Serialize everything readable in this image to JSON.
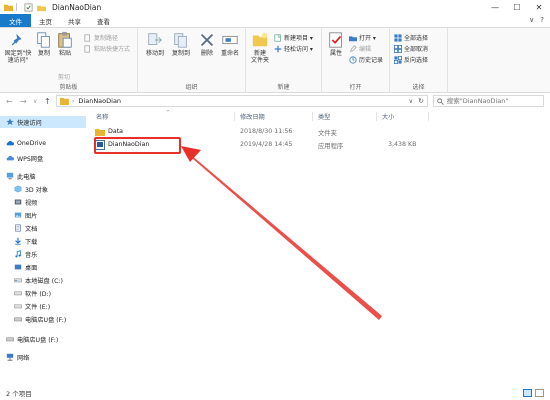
{
  "window": {
    "title": "DianNaoDian",
    "minimize": "—",
    "maximize": "☐",
    "close": "✕"
  },
  "tabs": [
    {
      "label": "文件"
    },
    {
      "label": "主页"
    },
    {
      "label": "共享"
    },
    {
      "label": "查看"
    }
  ],
  "tabs_right": {
    "collapse": "∨",
    "help": "?"
  },
  "ribbon": {
    "clipboard": {
      "label": "剪贴板",
      "pin": "固定到\"快\n速访问\"",
      "copy": "复制",
      "paste": "粘贴",
      "copy_path": "复制路径",
      "paste_shortcut": "粘贴快捷方式",
      "cut": "剪切"
    },
    "organize": {
      "label": "组织",
      "move_to": "移动到",
      "copy_to": "复制到",
      "delete": "删除",
      "rename": "重命名"
    },
    "new": {
      "label": "新建",
      "new_folder": "新建\n文件夹",
      "new_item": "新建项目 ▾",
      "easy_access": "轻松访问 ▾"
    },
    "open": {
      "label": "打开",
      "properties": "属性",
      "open": "打开 ▾",
      "edit": "编辑",
      "history": "历史记录"
    },
    "select": {
      "label": "选择",
      "select_all": "全部选择",
      "select_none": "全部取消",
      "invert": "反向选择"
    }
  },
  "address": {
    "back": "←",
    "forward": "→",
    "recent": "∨",
    "up": "↑",
    "path": "DianNaoDian",
    "dropdown": "∨",
    "refresh": "↻",
    "search_placeholder": "搜索\"DianNaoDian\""
  },
  "nav": [
    {
      "label": "快速访问",
      "icon": "star-icon"
    },
    {
      "label": "OneDrive",
      "icon": "cloud-icon"
    },
    {
      "label": "WPS网盘",
      "icon": "cloud-icon"
    },
    {
      "label": "此电脑",
      "icon": "computer-icon"
    },
    {
      "label": "3D 对象",
      "icon": "cube-icon"
    },
    {
      "label": "视频",
      "icon": "video-icon"
    },
    {
      "label": "图片",
      "icon": "picture-icon"
    },
    {
      "label": "文档",
      "icon": "document-icon"
    },
    {
      "label": "下载",
      "icon": "download-icon"
    },
    {
      "label": "音乐",
      "icon": "music-icon"
    },
    {
      "label": "桌面",
      "icon": "desktop-icon"
    },
    {
      "label": "本地磁盘 (C:)",
      "icon": "drive-icon"
    },
    {
      "label": "软件 (D:)",
      "icon": "drive-icon"
    },
    {
      "label": "文件 (E:)",
      "icon": "drive-icon"
    },
    {
      "label": "电脑店U盘 (F:)",
      "icon": "usb-drive-icon"
    },
    {
      "label": "电脑店U盘 (F:)",
      "icon": "usb-drive-icon"
    },
    {
      "label": "网络",
      "icon": "network-icon"
    }
  ],
  "columns": {
    "name": "名称",
    "date": "修改日期",
    "type": "类型",
    "size": "大小",
    "sort_indicator": "^"
  },
  "files": [
    {
      "name": "Data",
      "date": "2018/8/30 11:56",
      "type": "文件夹",
      "size": "",
      "icon": "folder-icon"
    },
    {
      "name": "DianNaoDian",
      "date": "2019/4/28 14:45",
      "type": "应用程序",
      "size": "3,438 KB",
      "icon": "application-icon"
    }
  ],
  "status": {
    "count": "2 个项目"
  },
  "colors": {
    "accent": "#1979ca",
    "selection": "#cce8ff",
    "annotation": "#e8302a"
  }
}
